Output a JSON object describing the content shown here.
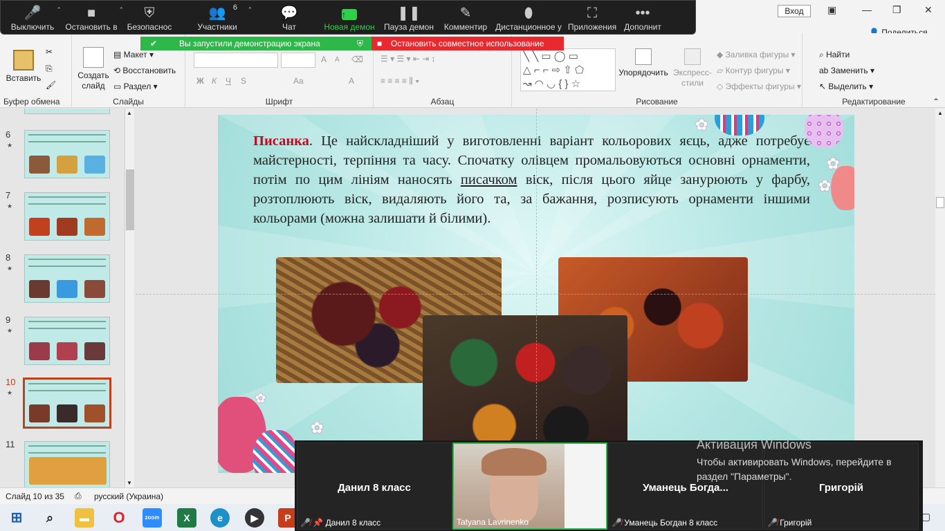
{
  "zoom": {
    "buttons": [
      {
        "label": "Выключить",
        "icon": "microphone-icon"
      },
      {
        "label": "Остановить в",
        "icon": "video-camera-icon"
      },
      {
        "label": "Безопаснос",
        "icon": "shield-icon"
      },
      {
        "label": "Участники",
        "icon": "participants-icon",
        "count": "6"
      },
      {
        "label": "Чат",
        "icon": "chat-icon"
      },
      {
        "label": "Новая демон",
        "icon": "share-screen-icon"
      },
      {
        "label": "Пауза демон",
        "icon": "pause-icon"
      },
      {
        "label": "Комментир",
        "icon": "pencil-icon"
      },
      {
        "label": "Дистанционное у",
        "icon": "mouse-icon"
      },
      {
        "label": "Приложения",
        "icon": "apps-icon"
      },
      {
        "label": "Дополнит",
        "icon": "more-icon"
      }
    ],
    "share_banner": "Вы запустили демонстрацию экрана",
    "stop_share": "Остановить совместное использование"
  },
  "titlebar": {
    "signin": "Вход",
    "share": "Поделиться"
  },
  "ribbon": {
    "clipboard": {
      "paste": "Вставить",
      "label": "Буфер обмена"
    },
    "slides": {
      "create": "Создать слайд",
      "layout": "Макет",
      "reset": "Восстановить",
      "section": "Раздел",
      "label": "Слайды"
    },
    "font": {
      "label": "Шрифт",
      "bold": "Ж",
      "italic": "К",
      "underline": "Ч",
      "strike": "S",
      "size_up": "A",
      "size_down": "A",
      "aa": "Aa",
      "color": "A"
    },
    "paragraph": {
      "label": "Абзац"
    },
    "drawing": {
      "arrange": "Упорядочить",
      "quick_styles": "Экспресс-стили",
      "fill": "Заливка фигуры",
      "outline": "Контур фигуры",
      "effects": "Эффекты фигуры",
      "label": "Рисование"
    },
    "editing": {
      "find": "Найти",
      "replace": "Заменить",
      "select": "Выделить",
      "label": "Редактирование"
    }
  },
  "thumbnails": [
    {
      "num": "6",
      "selected": false
    },
    {
      "num": "7",
      "selected": false
    },
    {
      "num": "8",
      "selected": false
    },
    {
      "num": "9",
      "selected": false
    },
    {
      "num": "10",
      "selected": true
    },
    {
      "num": "11",
      "selected": false
    }
  ],
  "slide": {
    "keyword": "Писанка",
    "text_after_keyword": ". Це найскладніший у виготовленні варіант кольорових яєць, адже потребує майстерності, терпіння та часу. Спочатку олівцем промальовуються основні орнаменти, потім по цим лініям наносять ",
    "underlined": "писачком",
    "text_end": " віск, після цього яйце занурюють у фарбу, розтоплюють віск, видаляють його та, за бажання, розписують орнаменти іншими кольорами (можна залишати й білими)."
  },
  "status": {
    "slide": "Слайд 10 из 35",
    "language": "русский (Украина)"
  },
  "meeting": {
    "tiles": [
      {
        "name": "Данил 8 класс",
        "label": "Данил 8 класс"
      },
      {
        "name": "",
        "label": "Tatyana Lavrinenko"
      },
      {
        "name": "Уманець  Богда...",
        "label": "Уманець Богдан 8 класс"
      },
      {
        "name": "Григорій",
        "label": "Григорій"
      }
    ]
  },
  "windows_activation": {
    "title": "Активация Windows",
    "line1": "Чтобы активировать Windows, перейдите в",
    "line2": "раздел \"Параметры\"."
  },
  "taskbar": {
    "apps": [
      "start",
      "search",
      "file-explorer",
      "opera",
      "zoom",
      "excel",
      "edge",
      "media-player",
      "powerpoint"
    ]
  }
}
